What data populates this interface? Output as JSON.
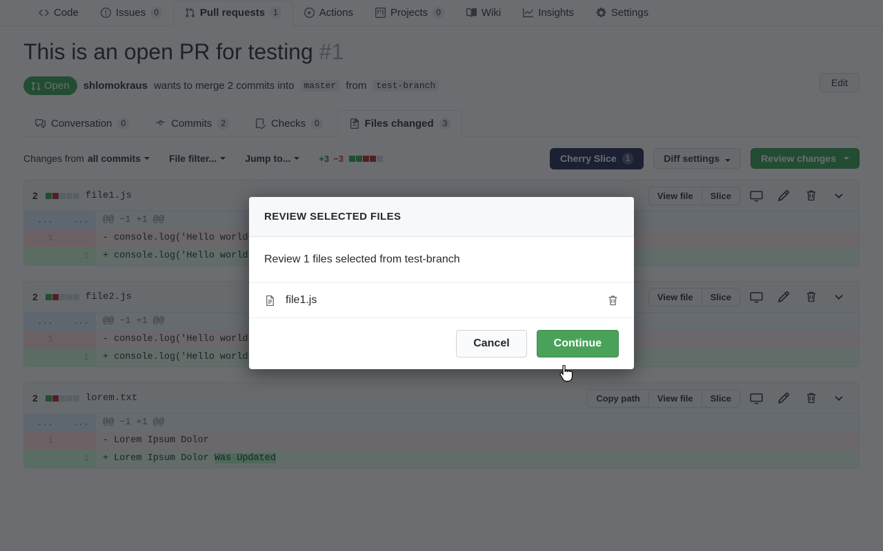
{
  "repo_nav": {
    "items": [
      {
        "label": "Code",
        "icon": "code-icon",
        "count": null,
        "selected": false
      },
      {
        "label": "Issues",
        "icon": "issue-opened-icon",
        "count": "0",
        "selected": false
      },
      {
        "label": "Pull requests",
        "icon": "git-pull-request-icon",
        "count": "1",
        "selected": true
      },
      {
        "label": "Actions",
        "icon": "play-icon",
        "count": null,
        "selected": false
      },
      {
        "label": "Projects",
        "icon": "project-icon",
        "count": "0",
        "selected": false
      },
      {
        "label": "Wiki",
        "icon": "book-icon",
        "count": null,
        "selected": false
      },
      {
        "label": "Insights",
        "icon": "graph-icon",
        "count": null,
        "selected": false
      },
      {
        "label": "Settings",
        "icon": "gear-icon",
        "count": null,
        "selected": false
      }
    ]
  },
  "pr": {
    "title": "This is an open PR for testing",
    "number": "#1",
    "edit_label": "Edit",
    "state": "Open",
    "author": "shlomokraus",
    "wants_text": "wants to merge 2 commits into",
    "base_branch": "master",
    "from_text": "from",
    "head_branch": "test-branch"
  },
  "pr_tabs": [
    {
      "label": "Conversation",
      "count": "0",
      "icon": "comment-discussion-icon",
      "selected": false
    },
    {
      "label": "Commits",
      "count": "2",
      "icon": "git-commit-icon",
      "selected": false
    },
    {
      "label": "Checks",
      "count": "0",
      "icon": "checklist-icon",
      "selected": false
    },
    {
      "label": "Files changed",
      "count": "3",
      "icon": "file-diff-icon",
      "selected": true
    }
  ],
  "diff_toolbar": {
    "changes_from_label": "Changes from",
    "changes_from_value": "all commits",
    "file_filter_label": "File filter...",
    "jump_to_label": "Jump to...",
    "additions": "+3",
    "deletions": "−3",
    "blocks": [
      "g",
      "g",
      "r",
      "r",
      "n"
    ],
    "cherry_slice_label": "Cherry Slice",
    "cherry_slice_count": "1",
    "diff_settings_label": "Diff settings",
    "review_changes_label": "Review changes"
  },
  "files": [
    {
      "changes": "2",
      "blocks": [
        "g",
        "r",
        "n",
        "n",
        "n"
      ],
      "name": "file1.js",
      "actions": [
        "View file",
        "Slice"
      ],
      "icons": [
        "screen-icon",
        "pencil-icon",
        "trash-icon",
        "chevron-down-icon"
      ],
      "hunk": "@@ −1 +1 @@",
      "lines": [
        {
          "type": "del",
          "old": "1",
          "new": "",
          "sign": "-",
          "code": "console.log('Hello world from a file')"
        },
        {
          "type": "add",
          "old": "",
          "new": "1",
          "sign": "+",
          "code": "console.log('Hello world again from a file')"
        }
      ]
    },
    {
      "changes": "2",
      "blocks": [
        "g",
        "r",
        "n",
        "n",
        "n"
      ],
      "name": "file2.js",
      "actions": [
        "View file",
        "Slice"
      ],
      "icons": [
        "screen-icon",
        "pencil-icon",
        "trash-icon",
        "chevron-down-icon"
      ],
      "hunk": "@@ −1 +1 @@",
      "lines": [
        {
          "type": "del",
          "old": "1",
          "new": "",
          "sign": "-",
          "code": "console.log('Hello world from another file')"
        },
        {
          "type": "add",
          "old": "",
          "new": "1",
          "sign": "+",
          "code": "console.log('Hello world again from another file')"
        }
      ]
    },
    {
      "changes": "2",
      "blocks": [
        "g",
        "r",
        "n",
        "n",
        "n"
      ],
      "name": "lorem.txt",
      "actions": [
        "Copy path",
        "View file",
        "Slice"
      ],
      "icons": [
        "screen-icon",
        "pencil-icon",
        "trash-icon",
        "chevron-down-icon"
      ],
      "hunk": "@@ −1 +1 @@",
      "lines": [
        {
          "type": "del",
          "old": "1",
          "new": "",
          "sign": "-",
          "code": "Lorem Ipsum Dolor"
        },
        {
          "type": "add",
          "old": "",
          "new": "1",
          "sign": "+",
          "code": "Lorem Ipsum Dolor ",
          "highlight": "Was Updated"
        }
      ]
    }
  ],
  "modal": {
    "title": "REVIEW SELECTED FILES",
    "body_text": "Review 1 files selected from test-branch",
    "file_name": "file1.js",
    "file_icon": "file-icon",
    "delete_icon": "trash-icon",
    "cancel_label": "Cancel",
    "continue_label": "Continue"
  },
  "colors": {
    "green": "#2ea44f",
    "cherry_navy": "#1f2352",
    "add_bg": "#e6ffed",
    "del_bg": "#ffeef0"
  }
}
